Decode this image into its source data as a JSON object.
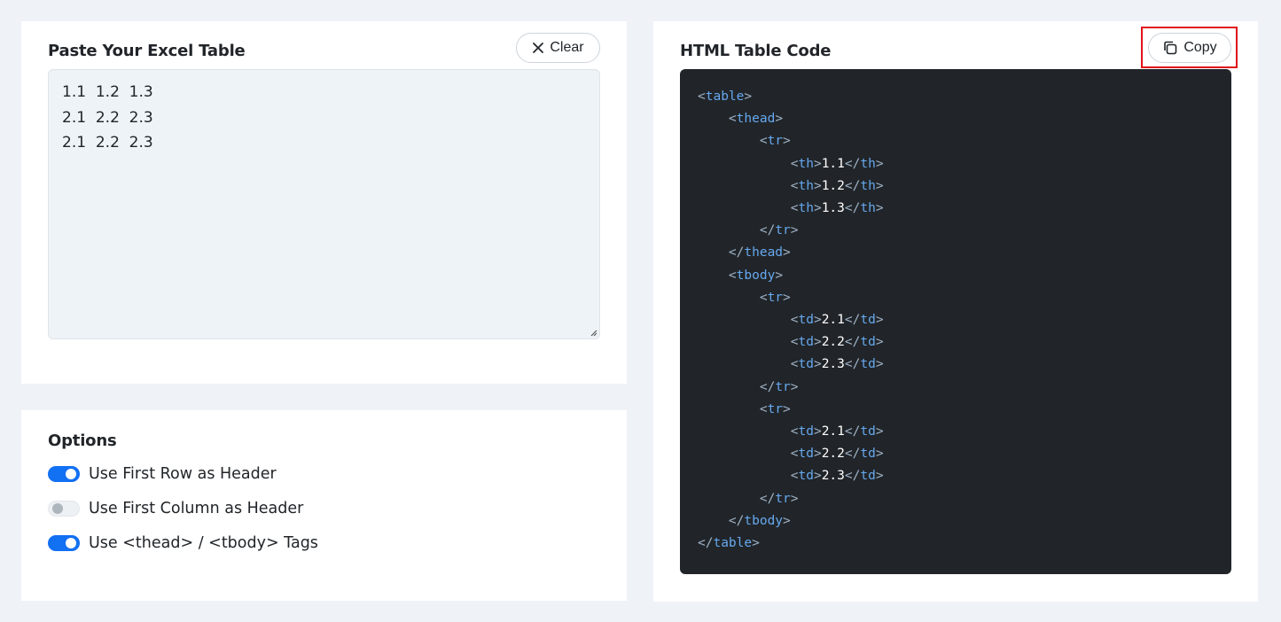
{
  "paste_panel": {
    "title": "Paste Your Excel Table",
    "clear_label": "Clear",
    "rows": [
      "1.1  1.2  1.3",
      "2.1  2.2  2.3",
      "2.1  2.2  2.3"
    ]
  },
  "options_panel": {
    "title": "Options",
    "items": [
      {
        "label": "Use First Row as Header",
        "enabled": true
      },
      {
        "label": "Use First Column as Header",
        "enabled": false
      },
      {
        "label": "Use <thead> / <tbody> Tags",
        "enabled": true
      }
    ]
  },
  "output_panel": {
    "title": "HTML Table Code",
    "copy_label": "Copy",
    "code_lines": [
      {
        "indent": 0,
        "tag": "table",
        "close": false
      },
      {
        "indent": 1,
        "tag": "thead",
        "close": false
      },
      {
        "indent": 2,
        "tag": "tr",
        "close": false
      },
      {
        "indent": 3,
        "tag": "th",
        "text": "1.1"
      },
      {
        "indent": 3,
        "tag": "th",
        "text": "1.2"
      },
      {
        "indent": 3,
        "tag": "th",
        "text": "1.3"
      },
      {
        "indent": 2,
        "tag": "tr",
        "close": true
      },
      {
        "indent": 1,
        "tag": "thead",
        "close": true
      },
      {
        "indent": 1,
        "tag": "tbody",
        "close": false
      },
      {
        "indent": 2,
        "tag": "tr",
        "close": false
      },
      {
        "indent": 3,
        "tag": "td",
        "text": "2.1"
      },
      {
        "indent": 3,
        "tag": "td",
        "text": "2.2"
      },
      {
        "indent": 3,
        "tag": "td",
        "text": "2.3"
      },
      {
        "indent": 2,
        "tag": "tr",
        "close": true
      },
      {
        "indent": 2,
        "tag": "tr",
        "close": false
      },
      {
        "indent": 3,
        "tag": "td",
        "text": "2.1"
      },
      {
        "indent": 3,
        "tag": "td",
        "text": "2.2"
      },
      {
        "indent": 3,
        "tag": "td",
        "text": "2.3"
      },
      {
        "indent": 2,
        "tag": "tr",
        "close": true
      },
      {
        "indent": 1,
        "tag": "tbody",
        "close": true
      },
      {
        "indent": 0,
        "tag": "table",
        "close": true
      }
    ]
  },
  "colors": {
    "accent": "#1270f3",
    "code_bg": "#212529",
    "tag": "#66a8ef",
    "highlight": "#e0121b"
  },
  "icons": {
    "clear": "close-icon",
    "copy": "copy-icon",
    "resize": "resize-grip-icon"
  }
}
